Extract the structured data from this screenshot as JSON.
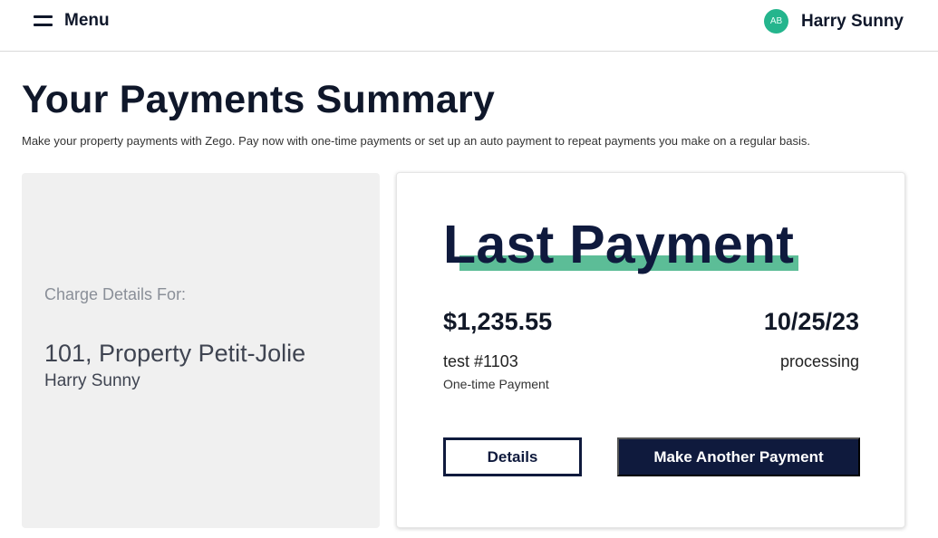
{
  "header": {
    "menu_label": "Menu",
    "avatar_initials": "AB",
    "user_name": "Harry Sunny",
    "avatar_color": "#24b58d"
  },
  "page": {
    "title": "Your Payments Summary",
    "description": "Make your property payments with Zego. Pay now with one-time payments or set up an auto payment to repeat payments you make on a regular basis."
  },
  "charge_details": {
    "label": "Charge Details For:",
    "property": "101, Property Petit-Jolie",
    "owner": "Harry Sunny"
  },
  "last_payment": {
    "title": "Last Payment",
    "amount": "$1,235.55",
    "date": "10/25/23",
    "reference": "test #1103",
    "status": "processing",
    "payment_type": "One-time Payment",
    "details_button": "Details",
    "make_payment_button": "Make Another Payment",
    "accent_color": "#5cbd97",
    "button_color": "#0f1a3d"
  }
}
